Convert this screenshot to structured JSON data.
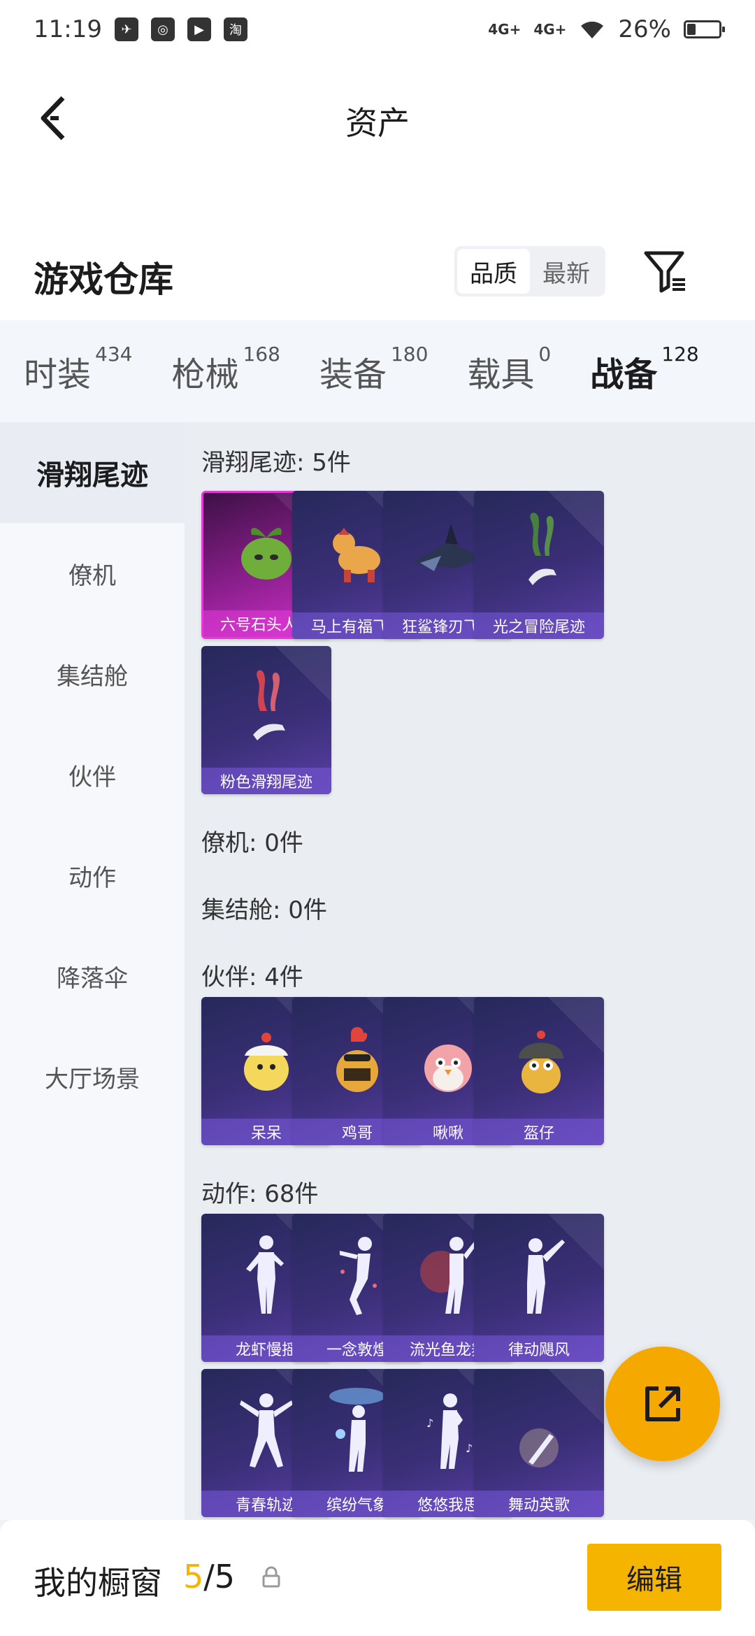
{
  "status_bar": {
    "time": "11:19",
    "signal1": "4G+",
    "signal2": "4G+",
    "battery": "26%",
    "battery_level": 0.26
  },
  "header": {
    "title": "资产"
  },
  "section": {
    "title": "游戏仓库",
    "sort_options": [
      "品质",
      "最新"
    ]
  },
  "categories": [
    {
      "label": "时装",
      "count": "434"
    },
    {
      "label": "枪械",
      "count": "168"
    },
    {
      "label": "装备",
      "count": "180"
    },
    {
      "label": "载具",
      "count": "0"
    },
    {
      "label": "战备",
      "count": "128"
    }
  ],
  "sidebar": {
    "items": [
      "滑翔尾迹",
      "僚机",
      "集结舱",
      "伙伴",
      "动作",
      "降落伞",
      "大厅场景"
    ]
  },
  "sections": {
    "glide": {
      "title": "滑翔尾迹: 5件",
      "items": [
        "六号石头人…",
        "马上有福飞…",
        "狂鲨锋刃飞…",
        "光之冒险尾迹",
        "粉色滑翔尾迹"
      ]
    },
    "wingman": {
      "title": "僚机: 0件"
    },
    "pod": {
      "title": "集结舱: 0件"
    },
    "partner": {
      "title": "伙伴: 4件",
      "items": [
        "呆呆",
        "鸡哥",
        "啾啾",
        "盔仔"
      ]
    },
    "emote": {
      "title": "动作: 68件",
      "items": [
        "龙虾慢摇",
        "一念敦煌",
        "流光鱼龙舞",
        "律动飓风",
        "青春轨迹",
        "缤纷气象",
        "悠悠我思",
        "舞动英歌"
      ]
    }
  },
  "bottom": {
    "label": "我的橱窗",
    "current": "5",
    "separator": "/",
    "total": "5",
    "edit": "编辑"
  },
  "colors": {
    "accent": "#f5b400",
    "card_dark": "#2d2b66",
    "card_legendary": "#c02cbc"
  }
}
